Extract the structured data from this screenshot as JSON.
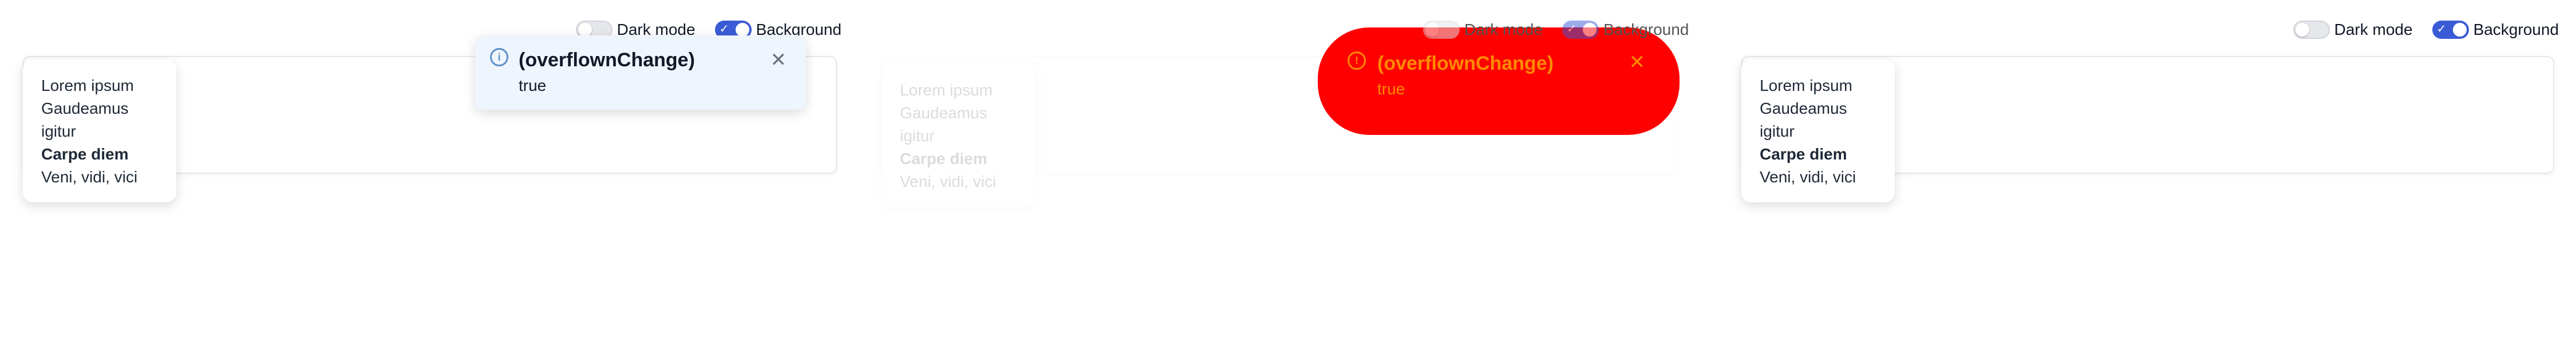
{
  "toggles": {
    "dark_mode": "Dark mode",
    "background": "Background"
  },
  "tooltip": {
    "line1": "Lorem ipsum",
    "line2": "Gaudeamus",
    "line3": "igitur",
    "line4": "Carpe diem",
    "line5": "Veni, vidi, vici"
  },
  "notification": {
    "title": "(overflownChange)",
    "body": "true",
    "close_icon": "close-icon",
    "info_icon": "info-icon"
  },
  "colors": {
    "accent": "#3b5bd6",
    "notification_bg": "#eef5fd",
    "error_bg": "#ff0000",
    "error_text": "#ff8a00"
  }
}
